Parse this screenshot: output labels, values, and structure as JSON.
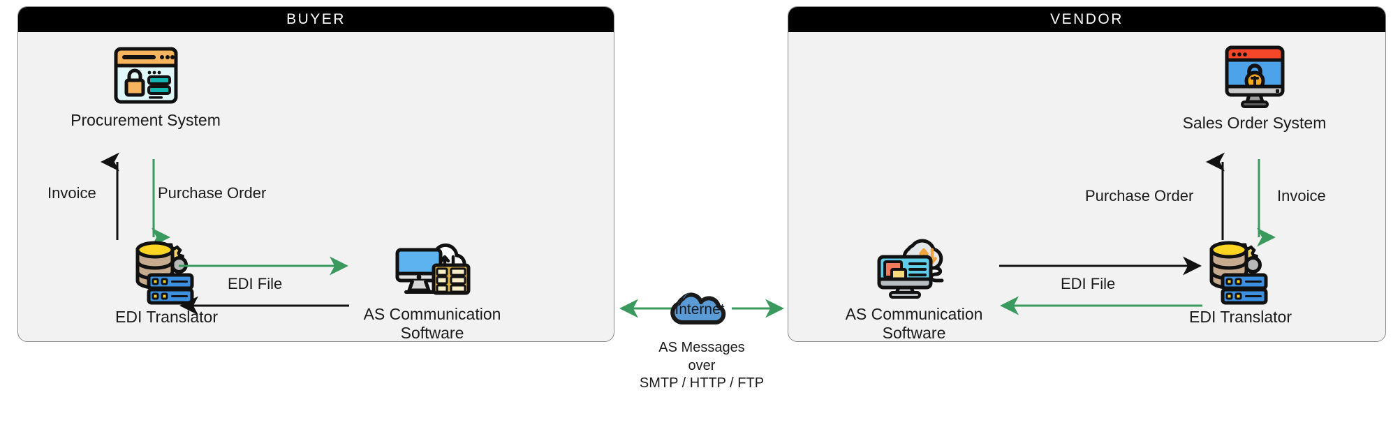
{
  "diagram": {
    "title_buyer": "BUYER",
    "title_vendor": "VENDOR"
  },
  "colors": {
    "panel_header_bg": "#000000",
    "panel_body_bg": "#f2f2f2",
    "panel_border": "#8a8a8a",
    "green_arrow": "#3a9a5e",
    "black_arrow": "#111111",
    "cloud_blue": "#5b9bd5",
    "cloud_outline": "#1a1a1a",
    "text": "#1a1a1a"
  },
  "buyer": {
    "header": "BUYER",
    "nodes": {
      "procurement": {
        "label": "Procurement System",
        "icon": "procurement-system-icon"
      },
      "translator": {
        "label": "EDI Translator",
        "icon": "edi-translator-icon"
      },
      "as_software": {
        "label": "AS Communication\nSoftware",
        "icon": "as-communication-software-icon"
      }
    },
    "edges": {
      "invoice_up": {
        "label": "Invoice",
        "color": "#111111",
        "direction": "up"
      },
      "purchase_order_dn": {
        "label": "Purchase Order",
        "color": "#3a9a5e",
        "direction": "down"
      },
      "edi_file_right": {
        "label": "EDI File",
        "color": "#3a9a5e",
        "direction": "right"
      },
      "edi_file_left": {
        "label": "",
        "color": "#111111",
        "direction": "left"
      }
    }
  },
  "vendor": {
    "header": "VENDOR",
    "nodes": {
      "sales_order": {
        "label": "Sales Order System",
        "icon": "sales-order-system-icon"
      },
      "translator": {
        "label": "EDI Translator",
        "icon": "edi-translator-icon"
      },
      "as_software": {
        "label": "AS Communication\nSoftware",
        "icon": "as-communication-software-icon"
      }
    },
    "edges": {
      "purchase_order_up": {
        "label": "Purchase Order",
        "color": "#111111",
        "direction": "up"
      },
      "invoice_dn": {
        "label": "Invoice",
        "color": "#3a9a5e",
        "direction": "down"
      },
      "edi_file_right": {
        "label": "EDI File",
        "color": "#111111",
        "direction": "right"
      },
      "edi_file_left": {
        "label": "",
        "color": "#3a9a5e",
        "direction": "left"
      }
    }
  },
  "center": {
    "cloud_label": "Internet",
    "caption": "AS Messages\nover\nSMTP / HTTP / FTP",
    "arrow_left_direction": "left",
    "arrow_right_direction": "right",
    "arrow_color": "#3a9a5e"
  }
}
